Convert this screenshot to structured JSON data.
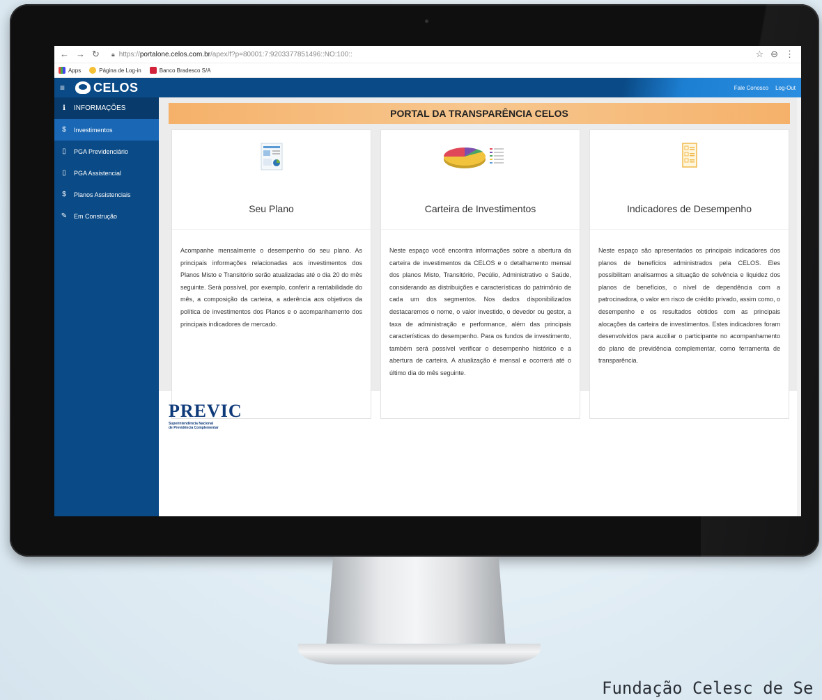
{
  "browser": {
    "url_prefix": "https://",
    "url_main": "portalone.celos.com.br",
    "url_rest": "/apex/f?p=80001:7:9203377851496::NO:100::",
    "bookmarks": [
      "Apps",
      "Página de Log-in",
      "Banco Bradesco S/A"
    ]
  },
  "app": {
    "logo": "CELOS",
    "links": [
      "Fale Conosco",
      "Log-Out"
    ]
  },
  "sidebar": {
    "items": [
      {
        "label": "INFORMAÇÕES",
        "icon": "info-icon"
      },
      {
        "label": "Investimentos",
        "icon": "dollar-icon"
      },
      {
        "label": "PGA Previdenciário",
        "icon": "file-icon"
      },
      {
        "label": "PGA Assistencial",
        "icon": "file-icon"
      },
      {
        "label": "Planos Assistenciais",
        "icon": "dollar-icon"
      },
      {
        "label": "Em Construção",
        "icon": "file-edit-icon"
      }
    ]
  },
  "main": {
    "title": "PORTAL DA TRANSPARÊNCIA CELOS",
    "cards": [
      {
        "title": "Seu Plano",
        "text": "Acompanhe mensalmente o desempenho do seu plano. As principais informações relacionadas aos investimentos dos Planos Misto e Transitório serão atualizadas até o dia 20 do mês seguinte. Será possível, por exemplo, conferir a rentabilidade do mês, a composição da carteira, a aderência aos objetivos da política de investimentos dos Planos e o acompanhamento dos principais indicadores de mercado."
      },
      {
        "title": "Carteira de Investimentos",
        "text": "Neste espaço você encontra informações sobre a abertura da carteira de investimentos da CELOS e o detalhamento mensal dos planos Misto, Transitório, Pecúlio, Administrativo e Saúde, considerando as distribuições e características do patrimônio de cada um dos segmentos. Nos dados disponibilizados destacaremos o nome, o valor investido, o devedor ou gestor, a taxa de administração e performance, além das principais características do desempenho. Para os fundos de investimento, também será possível verificar o desempenho histórico e a abertura de carteira. A atualização é mensal e ocorrerá até o último dia do mês seguinte."
      },
      {
        "title": "Indicadores de Desempenho",
        "text": "Neste espaço são apresentados os principais indicadores dos planos de benefícios administrados pela CELOS. Eles possibilitam analisarmos a situação de solvência e liquidez dos planos de benefícios, o nível de dependência com a patrocinadora, o valor em risco de crédito privado, assim como, o desempenho e os resultados obtidos com as principais alocações da carteira de investimentos. Estes indicadores foram desenvolvidos para auxiliar o participante no acompanhamento do plano de previdência complementar, como ferramenta de transparência."
      }
    ],
    "previc": {
      "name": "PREVIC",
      "line1": "Superintendência Nacional",
      "line2": "de Previdência Complementar"
    }
  },
  "caption": "Fundação Celesc de Se"
}
